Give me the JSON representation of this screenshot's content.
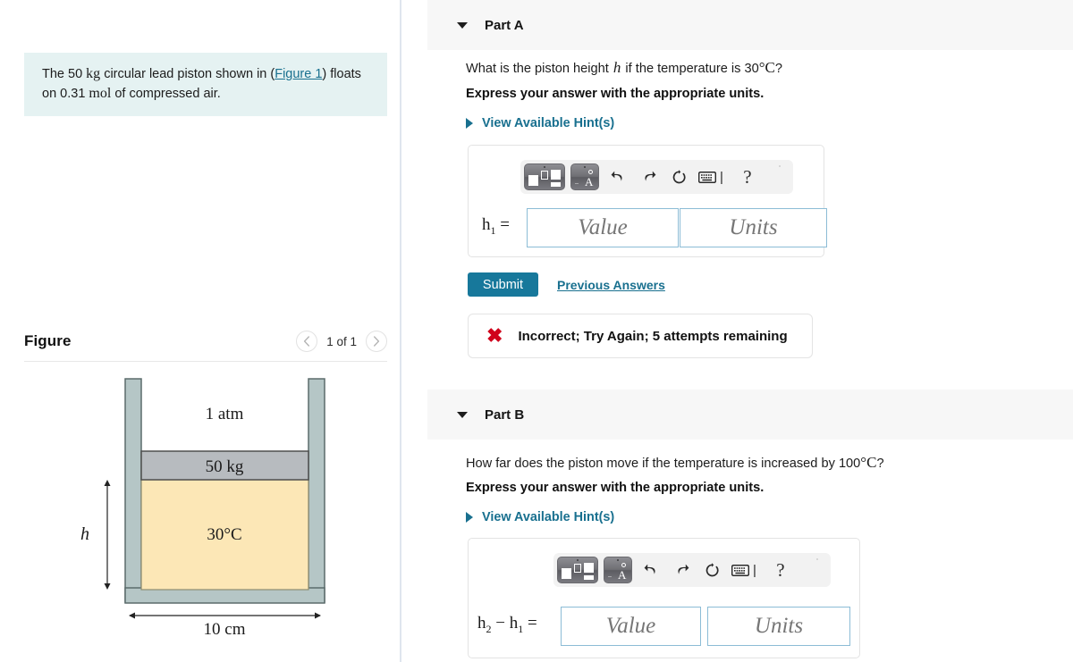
{
  "problem": {
    "text_before_unit1": "The 50 ",
    "unit1": "kg",
    "text_mid": " circular lead piston shown in (",
    "figure_link": "Figure 1",
    "text_after_link": ") floats on 0.31 ",
    "unit2": "mol",
    "text_end": " of compressed air."
  },
  "figure_panel": {
    "title": "Figure",
    "prev_icon": "chevron-left-icon",
    "next_icon": "chevron-right-icon",
    "counter": "1 of 1",
    "diagram": {
      "top_label": "1 atm",
      "piston_label": "50 kg",
      "gas_label": "30°C",
      "height_label": "h",
      "width_label": "10 cm",
      "colors": {
        "wall": "#b5c6c6",
        "wall_stroke": "#5b6b6b",
        "piston": "#b7bbbf",
        "piston_stroke": "#4f4f4f",
        "gas": "#fce7b6",
        "gas_stroke": "#8a8a6a"
      }
    }
  },
  "parts": [
    {
      "id": "a",
      "caret_icon": "caret-down-icon",
      "label": "Part A",
      "question_pre": "What is the piston height ",
      "question_var": "h",
      "question_mid": " if the temperature is 30",
      "question_unit": "°C",
      "question_end": "?",
      "instruction": "Express your answer with the appropriate units.",
      "hint_caret_icon": "caret-right-icon",
      "hint_label": "View Available Hint(s)",
      "toolbar": {
        "template_btn_1": "math-template-icon",
        "template_btn_2": "math-symbol-icon",
        "undo": "undo-icon",
        "redo": "redo-icon",
        "reset": "reset-icon",
        "keyboard": "keyboard-icon",
        "help": "?"
      },
      "equation_label_main": "h",
      "equation_label_sub": "1",
      "equation_equals": " =",
      "value_placeholder": "Value",
      "units_placeholder": "Units",
      "submit_label": "Submit",
      "previous_answers_label": "Previous Answers",
      "feedback_icon": "x-mark-icon",
      "feedback_text": "Incorrect; Try Again; 5 attempts remaining"
    },
    {
      "id": "b",
      "caret_icon": "caret-down-icon",
      "label": "Part B",
      "question_pre": "How far does the piston move if the temperature is increased by 100",
      "question_unit": "°C",
      "question_end": "?",
      "instruction": "Express your answer with the appropriate units.",
      "hint_caret_icon": "caret-right-icon",
      "hint_label": "View Available Hint(s)",
      "toolbar": {
        "template_btn_1": "math-template-icon",
        "template_btn_2": "math-symbol-icon",
        "undo": "undo-icon",
        "redo": "redo-icon",
        "reset": "reset-icon",
        "keyboard": "keyboard-icon",
        "help": "?"
      },
      "value_placeholder": "Value",
      "units_placeholder": "Units"
    }
  ],
  "colors": {
    "link": "#19708f",
    "submit_bg": "#17789b",
    "prompt_bg": "#e5f2f2",
    "part_header_bg": "#f7f7f7",
    "error_red": "#d0021b"
  }
}
